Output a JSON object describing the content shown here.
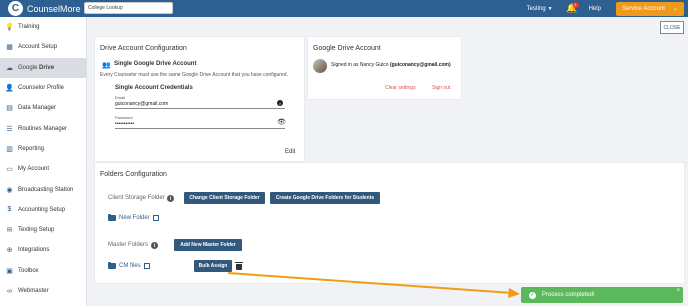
{
  "app": {
    "name": "CounselMore",
    "logo_letter": "C"
  },
  "top_bar": {
    "search_value": "College Lookup",
    "testing_label": "Testing",
    "notification_count": "1",
    "help_label": "Help",
    "service_account_label": "Service Account"
  },
  "sidebar": {
    "items": [
      {
        "label": "Training",
        "icon": "lightbulb-icon"
      },
      {
        "label": "Account Setup",
        "icon": "building-icon"
      },
      {
        "label": "Drive",
        "icon": "google-drive-icon",
        "active": true
      },
      {
        "label": "Counselor Profile",
        "icon": "person-icon"
      },
      {
        "label": "Data Manager",
        "icon": "table-icon"
      },
      {
        "label": "Routines Manager",
        "icon": "list-icon"
      },
      {
        "label": "Reporting",
        "icon": "chart-icon"
      },
      {
        "label": "My Account",
        "icon": "card-icon"
      },
      {
        "label": "Broadcasting Station",
        "icon": "broadcast-icon"
      },
      {
        "label": "Accounting Setup",
        "icon": "dollar-icon"
      },
      {
        "label": "Texting Setup",
        "icon": "chat-icon"
      },
      {
        "label": "Integrations",
        "icon": "plug-icon"
      },
      {
        "label": "Toolbox",
        "icon": "toolbox-icon"
      },
      {
        "label": "Webmaster",
        "icon": "link-icon"
      }
    ],
    "google_label": "Google"
  },
  "close_label": "CLOSE",
  "drive_config": {
    "title": "Drive Account Configuration",
    "mode_label": "Single Google Drive Account",
    "mode_desc": "Every Counselor must use the same Google Drive Account that you have configured.",
    "credentials_title": "Single Account Credentials",
    "email_label": "Email",
    "email_value": "guiconancy@gmail.com",
    "password_label": "Password",
    "password_value": "•••••••••••",
    "edit_label": "Edit"
  },
  "google_drive_account": {
    "title": "Google Drive Account",
    "signed_in_prefix": "Signed in as Nancy Guico",
    "signed_in_email": "(guiconancy@gmail.com)",
    "clear_settings": "Clear settings",
    "sign_out": "Sign out"
  },
  "folders": {
    "title": "Folders Configuration",
    "client_storage_label": "Client Storage Folder",
    "change_client_storage_btn": "Change Client Storage Folder",
    "create_folders_btn": "Create Google Drive Folders for Students",
    "new_folder_link": "New Folder",
    "master_folders_label": "Master Folders",
    "add_master_btn": "Add New Master Folder",
    "cm_files_link": "CM files",
    "bulk_assign_btn": "Bulk Assign"
  },
  "toast": {
    "message": "Process completed!",
    "close": "×"
  },
  "colors": {
    "topbar": "#2d5f91",
    "accent_orange": "#ef9a1a",
    "button_blue": "#33587e",
    "toast_green": "#5cb85c",
    "arrow_orange": "#f39c12"
  }
}
